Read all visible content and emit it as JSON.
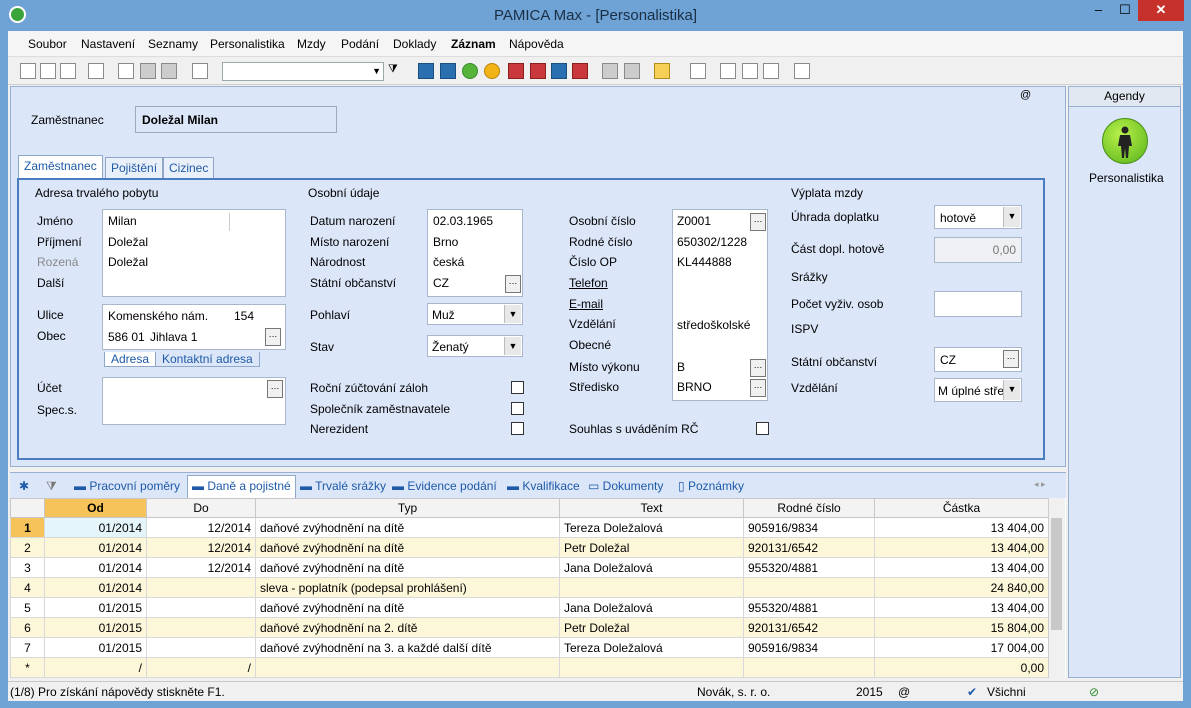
{
  "window": {
    "title": "PAMICA Max - [Personalistika]",
    "minimize": "–",
    "maximize": "☐",
    "close": "✕"
  },
  "menu": [
    "Soubor",
    "Nastavení",
    "Seznamy",
    "Personalistika",
    "Mzdy",
    "Podání",
    "Doklady",
    "Záznam",
    "Nápověda"
  ],
  "toolbar": {
    "icons": [
      "open-icon",
      "print-icon",
      "print-preview-icon",
      "find-icon",
      "new-icon",
      "save-icon",
      "save-all-icon",
      "copy-icon"
    ],
    "combo_value": "",
    "right_icons": [
      "filter-icon",
      "m-icon",
      "person-icon",
      "green-person-icon",
      "yellow-person-icon",
      "red-m-icon",
      "red-m-icon",
      "m-icon",
      "red-m-icon",
      "flag-icon",
      "flag-icon",
      "folder-icon",
      "calendar-icon",
      "note-icon",
      "list-icon",
      "list-icon",
      "help-icon"
    ]
  },
  "header": {
    "employee_label": "Zaměstnanec",
    "employee_name": "Doležal Milan",
    "at_sign": "@"
  },
  "tabs": [
    "Zaměstnanec",
    "Pojištění",
    "Cizinec"
  ],
  "address": {
    "section": "Adresa trvalého pobytu",
    "jmeno_label": "Jméno",
    "jmeno": "Milan",
    "prijmeni_label": "Příjmení",
    "prijmeni": "Doležal",
    "rozena_label": "Rozená",
    "rozena": "Doležal",
    "dalsi_label": "Další",
    "ulice_label": "Ulice",
    "ulice": "Komenského nám.",
    "cislo": "154",
    "obec_label": "Obec",
    "psc": "586 01",
    "obec": "Jihlava 1",
    "subtab_addr": "Adresa",
    "subtab_contact": "Kontaktní adresa",
    "ucet_label": "Účet",
    "spec_label": "Spec.s."
  },
  "personal": {
    "section": "Osobní údaje",
    "datum_label": "Datum narození",
    "datum": "02.03.1965",
    "misto_label": "Místo narození",
    "misto": "Brno",
    "narodnost_label": "Národnost",
    "narodnost": "česká",
    "obcanstvi_label": "Státní občanství",
    "obcanstvi": "CZ",
    "pohlavi_label": "Pohlaví",
    "pohlavi": "Muž",
    "stav_label": "Stav",
    "stav": "Ženatý",
    "rocni_label": "Roční zúčtování záloh",
    "spolecnik_label": "Společník zaměstnavatele",
    "nerezident_label": "Nerezident"
  },
  "ids": {
    "osobni_label": "Osobní číslo",
    "osobni": "Z0001",
    "rodne_label": "Rodné číslo",
    "rodne": "650302/1228",
    "op_label": "Číslo OP",
    "op": "KL444888",
    "telefon_label": "Telefon",
    "email_label": "E-mail",
    "vzdelani_label": "Vzdělání",
    "vzdelani": "středoškolské",
    "obecne_label": "Obecné",
    "misto_label": "Místo výkonu",
    "misto": "B",
    "stredisko_label": "Středisko",
    "stredisko": "BRNO",
    "souhlas_label": "Souhlas s uváděním RČ"
  },
  "payout": {
    "section": "Výplata mzdy",
    "uhrada_label": "Úhrada doplatku",
    "uhrada": "hotově",
    "cast_label": "Část dopl. hotově",
    "cast": "0,00",
    "srazky_label": "Srážky",
    "pocet_label": "Počet vyživ. osob",
    "ispv_label": "ISPV",
    "obcanstvi_label": "Státní občanství",
    "obcanstvi": "CZ",
    "vzdelani_label": "Vzdělání",
    "vzdelani": "M úplné stře"
  },
  "agenda": {
    "header": "Agendy",
    "item": "Personalistika"
  },
  "bottom_tabs": [
    "Pracovní poměry",
    "Daně a pojistné",
    "Trvalé srážky",
    "Evidence podání",
    "Kvalifikace",
    "Dokumenty",
    "Poznámky"
  ],
  "grid": {
    "columns": [
      "Od",
      "Do",
      "Typ",
      "Text",
      "Rodné číslo",
      "Částka"
    ],
    "rows": [
      [
        "1",
        "01/2014",
        "12/2014",
        "daňové zvýhodnění na dítě",
        "Tereza Doležalová",
        "905916/9834",
        "13 404,00"
      ],
      [
        "2",
        "01/2014",
        "12/2014",
        "daňové zvýhodnění na dítě",
        "Petr Doležal",
        "920131/6542",
        "13 404,00"
      ],
      [
        "3",
        "01/2014",
        "12/2014",
        "daňové zvýhodnění na dítě",
        "Jana Doležalová",
        "955320/4881",
        "13 404,00"
      ],
      [
        "4",
        "01/2014",
        "",
        "sleva - poplatník (podepsal prohlášení)",
        "",
        "",
        "24 840,00"
      ],
      [
        "5",
        "01/2015",
        "",
        "daňové zvýhodnění na dítě",
        "Jana Doležalová",
        "955320/4881",
        "13 404,00"
      ],
      [
        "6",
        "01/2015",
        "",
        "daňové zvýhodnění na 2. dítě",
        "Petr Doležal",
        "920131/6542",
        "15 804,00"
      ],
      [
        "7",
        "01/2015",
        "",
        "daňové zvýhodnění na 3. a každé další dítě",
        "Tereza Doležalová",
        "905916/9834",
        "17 004,00"
      ],
      [
        "*",
        "/",
        "/",
        "",
        "",
        "",
        "0,00"
      ]
    ]
  },
  "status": {
    "help": "(1/8) Pro získání nápovědy stiskněte F1.",
    "company": "Novák, s. r. o.",
    "year": "2015",
    "at": "@",
    "filter": "Všichni"
  }
}
